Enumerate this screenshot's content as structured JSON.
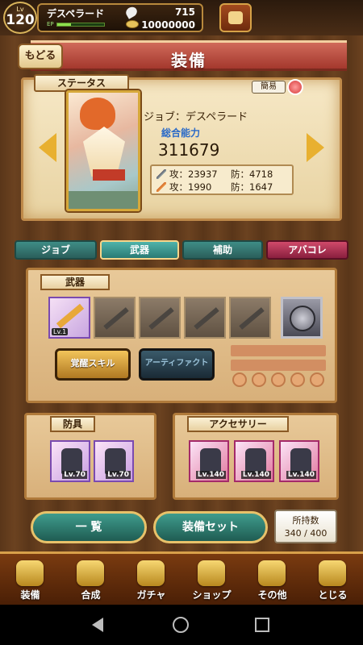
{
  "player": {
    "level_label": "Lv",
    "level": "120",
    "name": "デスペラード",
    "exp_label": "EP",
    "exp_fraction": 0.3,
    "gems": "715",
    "gold": "10000000"
  },
  "header": {
    "back_label": "もどる",
    "title": "装備"
  },
  "status": {
    "section_label": "ステータス",
    "simple_label": "簡易",
    "job_line": "ジョブ：デスペラード",
    "power_label": "総合能力",
    "power_value": "311679",
    "stats": [
      {
        "atk": "攻：23937",
        "def": "防：4718"
      },
      {
        "atk": "攻：1990",
        "def": "防：1647"
      }
    ]
  },
  "tabs": [
    {
      "label": "ジョブ"
    },
    {
      "label": "武器"
    },
    {
      "label": "補助"
    },
    {
      "label": "アバコレ"
    }
  ],
  "weapon": {
    "section_label": "武器",
    "equipped_level": "Lv.1",
    "awaken_label": "覚醒スキル",
    "artifact_label": "アーティファクト"
  },
  "armor": {
    "section_label": "防具",
    "items": [
      {
        "level": "Lv.70"
      },
      {
        "level": "Lv.70"
      }
    ]
  },
  "accessory": {
    "section_label": "アクセサリー",
    "items": [
      {
        "level": "Lv.140"
      },
      {
        "level": "Lv.140"
      },
      {
        "level": "Lv.140"
      }
    ]
  },
  "actions": {
    "list_label": "一 覧",
    "set_label": "装備セット",
    "capacity_label": "所持数",
    "capacity_value": "340 / 400"
  },
  "nav": [
    {
      "label": "装備",
      "icon": "equipment-icon"
    },
    {
      "label": "合成",
      "icon": "hammer-icon"
    },
    {
      "label": "ガチャ",
      "icon": "gacha-icon"
    },
    {
      "label": "ショップ",
      "icon": "crystal-icon"
    },
    {
      "label": "その他",
      "icon": "gear-icon"
    },
    {
      "label": "とじる",
      "icon": "close-icon"
    }
  ]
}
